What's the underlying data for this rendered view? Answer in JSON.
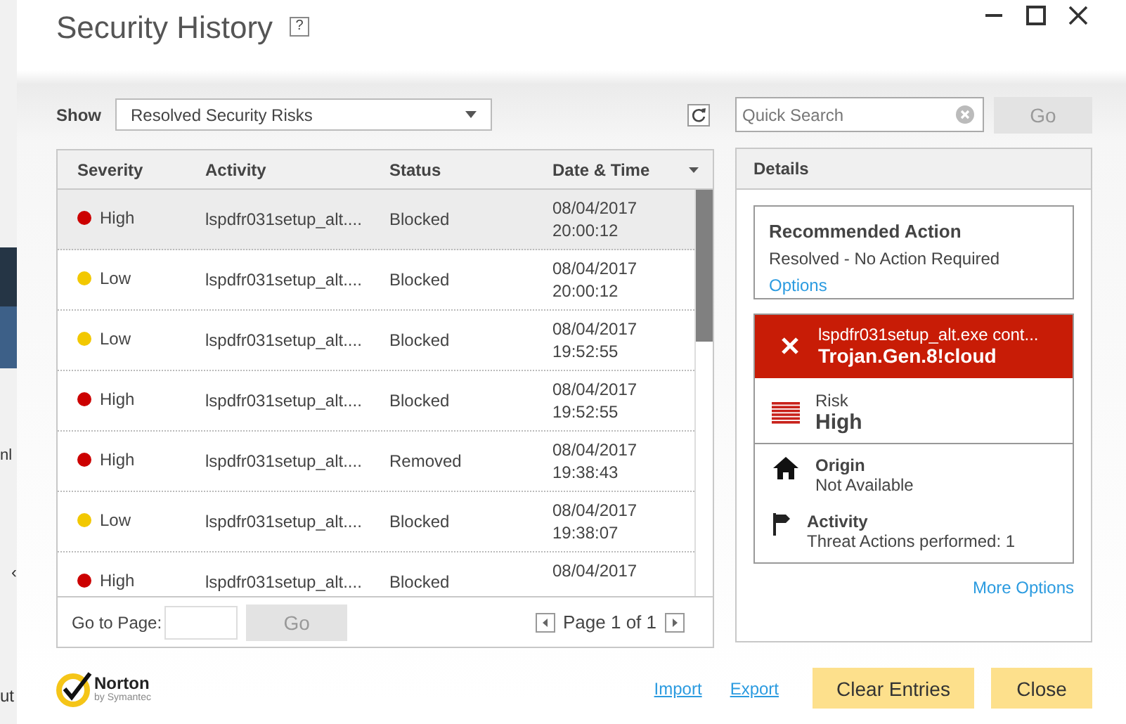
{
  "background_window": {
    "texts": [
      "nl",
      "‹",
      "ut"
    ]
  },
  "window": {
    "title": "Security History",
    "help": "?"
  },
  "filter": {
    "label": "Show",
    "value": "Resolved Security Risks"
  },
  "search": {
    "placeholder": "Quick Search",
    "button": "Go"
  },
  "table": {
    "columns": [
      "Severity",
      "Activity",
      "Status",
      "Date & Time"
    ],
    "rows": [
      {
        "severity": "High",
        "color": "#cc0000",
        "activity": "lspdfr031setup_alt....",
        "status": "Blocked",
        "datetime": [
          "08/04/2017",
          "20:00:12"
        ],
        "selected": true
      },
      {
        "severity": "Low",
        "color": "#f2c800",
        "activity": "lspdfr031setup_alt....",
        "status": "Blocked",
        "datetime": [
          "08/04/2017",
          "20:00:12"
        ],
        "selected": false
      },
      {
        "severity": "Low",
        "color": "#f2c800",
        "activity": "lspdfr031setup_alt....",
        "status": "Blocked",
        "datetime": [
          "08/04/2017",
          "19:52:55"
        ],
        "selected": false
      },
      {
        "severity": "High",
        "color": "#cc0000",
        "activity": "lspdfr031setup_alt....",
        "status": "Blocked",
        "datetime": [
          "08/04/2017",
          "19:52:55"
        ],
        "selected": false
      },
      {
        "severity": "High",
        "color": "#cc0000",
        "activity": "lspdfr031setup_alt....",
        "status": "Removed",
        "datetime": [
          "08/04/2017",
          "19:38:43"
        ],
        "selected": false
      },
      {
        "severity": "Low",
        "color": "#f2c800",
        "activity": "lspdfr031setup_alt....",
        "status": "Blocked",
        "datetime": [
          "08/04/2017",
          "19:38:07"
        ],
        "selected": false
      },
      {
        "severity": "High",
        "color": "#cc0000",
        "activity": "lspdfr031setup_alt....",
        "status": "Blocked",
        "datetime": [
          "08/04/2017"
        ],
        "selected": false
      }
    ],
    "pager": {
      "goto_label": "Go to Page:",
      "go": "Go",
      "page": "Page 1 of 1"
    }
  },
  "details": {
    "title": "Details",
    "recommended": {
      "title": "Recommended Action",
      "text": "Resolved - No Action Required",
      "link": "Options"
    },
    "threat": {
      "file": "lspdfr031setup_alt.exe cont...",
      "name": "Trojan.Gen.8!cloud"
    },
    "info": [
      {
        "kind": "risk",
        "label": "Risk",
        "value": "High"
      },
      {
        "kind": "origin",
        "label": "Origin",
        "value": "Not Available"
      },
      {
        "kind": "activity",
        "label": "Activity",
        "value": "Threat Actions performed: 1"
      }
    ],
    "more": "More Options"
  },
  "footer": {
    "logo": {
      "name": "Norton",
      "sub": "by Symantec"
    },
    "links": [
      "Import",
      "Export"
    ],
    "buttons": [
      "Clear Entries",
      "Close"
    ]
  }
}
